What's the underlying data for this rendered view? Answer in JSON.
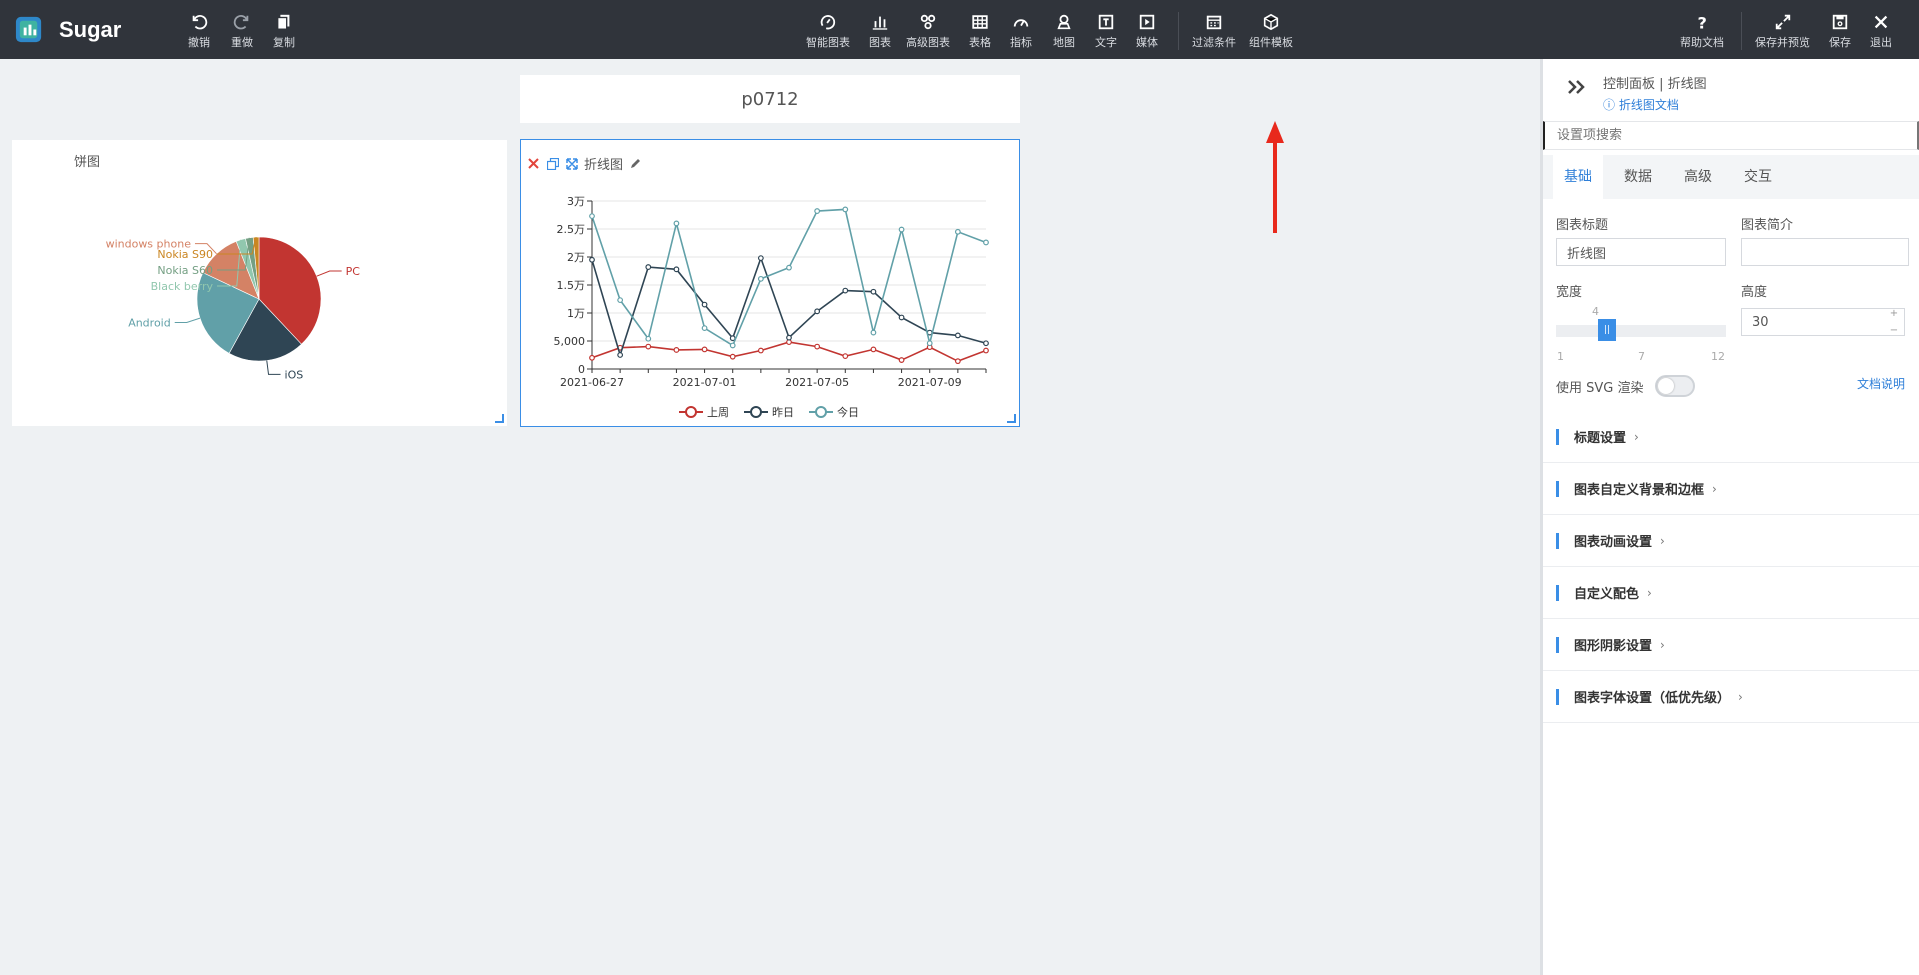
{
  "app": {
    "name": "Sugar"
  },
  "toolbar": {
    "undo": "撤销",
    "redo": "重做",
    "copy": "复制",
    "smart_chart": "智能图表",
    "chart": "图表",
    "advanced_chart": "高级图表",
    "table": "表格",
    "metric": "指标",
    "map": "地图",
    "text": "文字",
    "media": "媒体",
    "filter": "过滤条件",
    "component_template": "组件模板",
    "help": "帮助文档",
    "save_preview": "保存并预览",
    "save": "保存",
    "exit": "退出"
  },
  "report": {
    "title": "p0712"
  },
  "pie_card": {
    "title": "饼图",
    "chart_data": {
      "type": "pie",
      "slices": [
        {
          "label": "PC",
          "value": 38,
          "color": "#c23531"
        },
        {
          "label": "iOS",
          "value": 20,
          "color": "#2f4554"
        },
        {
          "label": "Android",
          "value": 24,
          "color": "#61a0a8"
        },
        {
          "label": "windows phone",
          "value": 12,
          "color": "#d48265"
        },
        {
          "label": "Black berry",
          "value": 2.5,
          "color": "#91c7ae"
        },
        {
          "label": "Nokia S60",
          "value": 2,
          "color": "#749f83"
        },
        {
          "label": "Nokia S90",
          "value": 1.5,
          "color": "#ca8622"
        }
      ]
    }
  },
  "line_card": {
    "title": "折线图",
    "chart_data": {
      "type": "line",
      "x": [
        "2021-06-27",
        "2021-06-28",
        "2021-06-29",
        "2021-06-30",
        "2021-07-01",
        "2021-07-02",
        "2021-07-03",
        "2021-07-04",
        "2021-07-05",
        "2021-07-06",
        "2021-07-07",
        "2021-07-08",
        "2021-07-09",
        "2021-07-10",
        "2021-07-11"
      ],
      "xticks": [
        "2021-06-27",
        "2021-07-01",
        "2021-07-05",
        "2021-07-09"
      ],
      "yticks": [
        {
          "value": 0,
          "label": "0"
        },
        {
          "value": 5000,
          "label": "5,000"
        },
        {
          "value": 10000,
          "label": "1万"
        },
        {
          "value": 15000,
          "label": "1.5万"
        },
        {
          "value": 20000,
          "label": "2万"
        },
        {
          "value": 25000,
          "label": "2.5万"
        },
        {
          "value": 30000,
          "label": "3万"
        }
      ],
      "ylim": [
        0,
        30000
      ],
      "series": [
        {
          "name": "上周",
          "color": "#c23531",
          "values": [
            2000,
            3800,
            4000,
            3400,
            3500,
            2200,
            3300,
            4800,
            4000,
            2300,
            3500,
            1600,
            3900,
            1400,
            3300
          ]
        },
        {
          "name": "昨日",
          "color": "#2f4554",
          "values": [
            19500,
            2500,
            18200,
            17800,
            11500,
            5500,
            19800,
            5600,
            10300,
            14000,
            13800,
            9200,
            6500,
            6000,
            4600
          ]
        },
        {
          "name": "今日",
          "color": "#61a0a8",
          "values": [
            27300,
            12300,
            5400,
            26000,
            7300,
            4200,
            16100,
            18100,
            28200,
            28500,
            6500,
            24900,
            4600,
            24500,
            22600
          ]
        }
      ]
    }
  },
  "panel": {
    "breadcrumb": "控制面板 | 折线图",
    "doc_link": "折线图文档",
    "search_placeholder": "设置项搜索",
    "tabs": [
      "基础",
      "数据",
      "高级",
      "交互"
    ],
    "chart_title_label": "图表标题",
    "chart_title_value": "折线图",
    "chart_desc_label": "图表简介",
    "width_label": "宽度",
    "width_value": "4",
    "width_min": "1",
    "width_mid": "7",
    "width_max": "12",
    "height_label": "高度",
    "height_value": "30",
    "svg_label": "使用 SVG 渲染",
    "doc_help": "文档说明",
    "sections": [
      "标题设置",
      "图表自定义背景和边框",
      "图表动画设置",
      "自定义配色",
      "图形阴影设置",
      "图表字体设置（低优先级）"
    ]
  }
}
